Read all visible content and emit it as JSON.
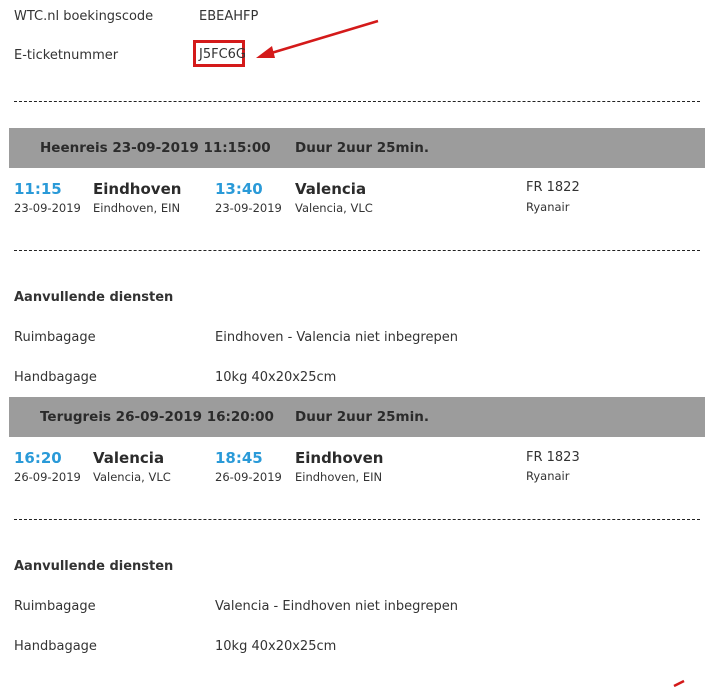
{
  "booking": {
    "code_label": "WTC.nl boekingscode",
    "code_value": "EBEAHFP",
    "ticket_label": "E-ticketnummer",
    "ticket_value": "J5FC6G"
  },
  "outbound": {
    "header": "Heenreis 23-09-2019 11:15:00",
    "duration": "Duur 2uur 25min.",
    "dep_time": "11:15",
    "dep_date": "23-09-2019",
    "dep_city": "Eindhoven",
    "dep_airport": "Eindhoven, EIN",
    "arr_time": "13:40",
    "arr_date": "23-09-2019",
    "arr_city": "Valencia",
    "arr_airport": "Valencia, VLC",
    "flight_no": "FR 1822",
    "airline": "Ryanair",
    "services_title": "Aanvullende diensten",
    "hold_label": "Ruimbagage",
    "hold_value": "Eindhoven - Valencia niet inbegrepen",
    "hand_label": "Handbagage",
    "hand_value": "10kg 40x20x25cm"
  },
  "return": {
    "header": "Terugreis 26-09-2019 16:20:00",
    "duration": "Duur 2uur 25min.",
    "dep_time": "16:20",
    "dep_date": "26-09-2019",
    "dep_city": "Valencia",
    "dep_airport": "Valencia, VLC",
    "arr_time": "18:45",
    "arr_date": "26-09-2019",
    "arr_city": "Eindhoven",
    "arr_airport": "Eindhoven, EIN",
    "flight_no": "FR 1823",
    "airline": "Ryanair",
    "services_title": "Aanvullende diensten",
    "hold_label": "Ruimbagage",
    "hold_value": "Valencia - Eindhoven niet inbegrepen",
    "hand_label": "Handbagage",
    "hand_value": "10kg 40x20x25cm"
  },
  "colors": {
    "accent_time": "#2a9ad8",
    "highlight_red": "#d41a1a",
    "band_gray": "#9c9c9c"
  }
}
